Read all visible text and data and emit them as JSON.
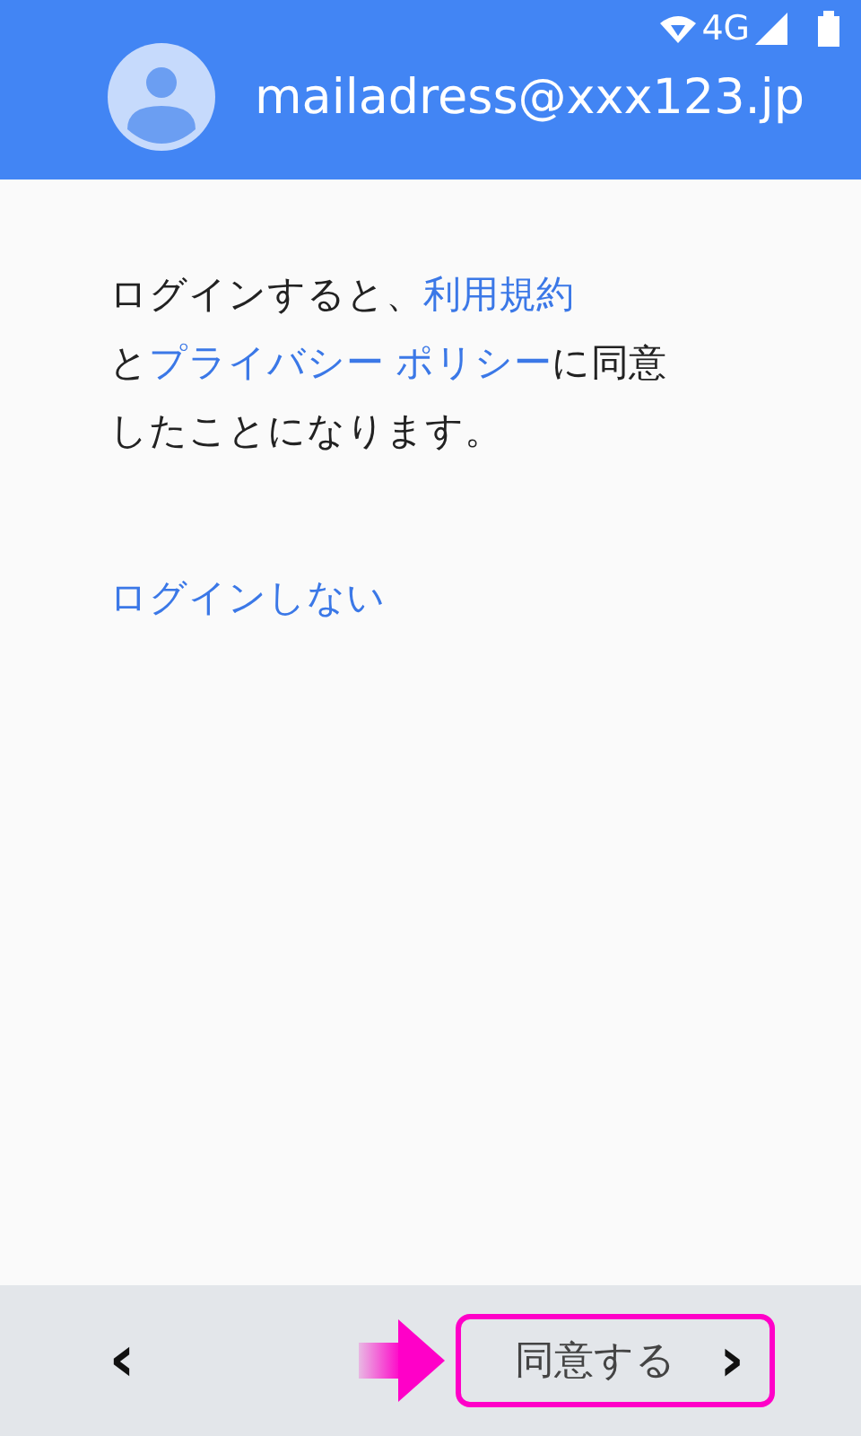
{
  "status_bar": {
    "network": "4G"
  },
  "header": {
    "account": "mailadress@xxx123.jp"
  },
  "notice": [
    [
      {
        "kind": "text",
        "text": "ログインすると、"
      },
      {
        "kind": "link",
        "text": "利用規約"
      }
    ],
    [
      {
        "kind": "text",
        "text": "と"
      },
      {
        "kind": "link",
        "text": "プライバシー ポリシー"
      },
      {
        "kind": "text",
        "text": "に同意"
      }
    ],
    [
      {
        "kind": "text",
        "text": "したことになります。"
      }
    ]
  ],
  "skip_link": "ログインしない",
  "bottom_bar": {
    "back": "‹",
    "next": {
      "label": "同意する",
      "chevron": "›",
      "highlighted": true
    }
  }
}
